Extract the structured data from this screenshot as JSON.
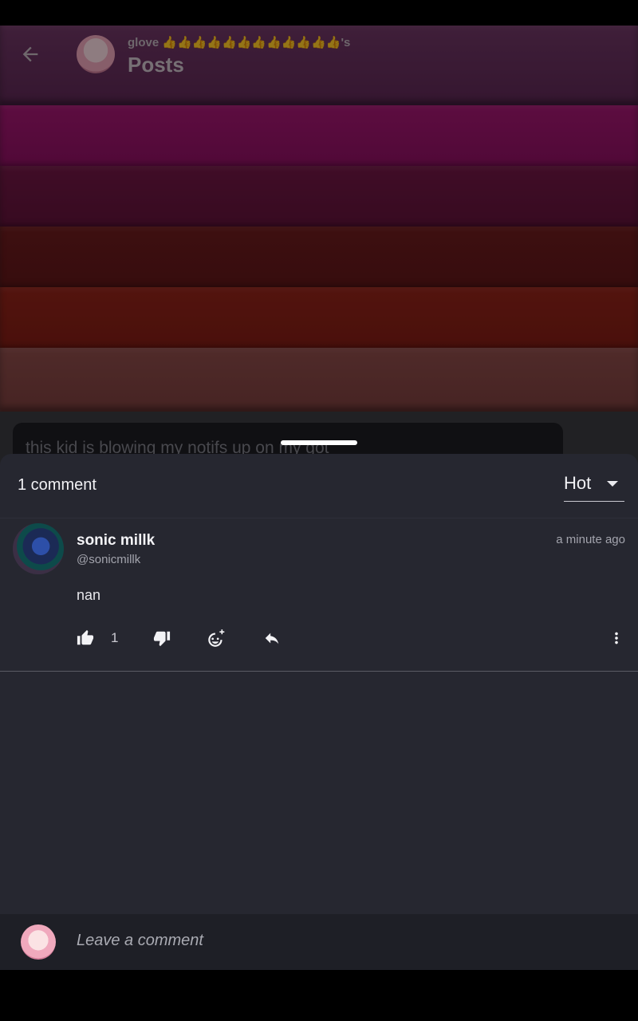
{
  "header": {
    "subtitle": "glove 👍👍👍👍👍👍👍👍👍👍👍👍's",
    "title": "Posts"
  },
  "post": {
    "preview_text": "this kid is blowing my notifs up on my got"
  },
  "comments_sheet": {
    "count_label": "1 comment",
    "sort": {
      "selected": "Hot"
    }
  },
  "comments": [
    {
      "name": "sonic millk",
      "handle": "@sonicmillk",
      "time": "a minute ago",
      "body": "nan",
      "likes": "1"
    }
  ],
  "composer": {
    "placeholder": "Leave a comment"
  },
  "icons": {
    "back": "arrow-left-icon",
    "like": "thumb-up-icon",
    "dislike": "thumb-down-icon",
    "react": "add-reaction-icon",
    "reply": "reply-icon",
    "more": "more-vertical-icon",
    "sort": "caret-down-icon"
  },
  "colors": {
    "sheet_bg": "#262730",
    "composer_bg": "#1e1f26",
    "text_primary": "#f1f1f4",
    "text_secondary": "#a3a4ad"
  }
}
